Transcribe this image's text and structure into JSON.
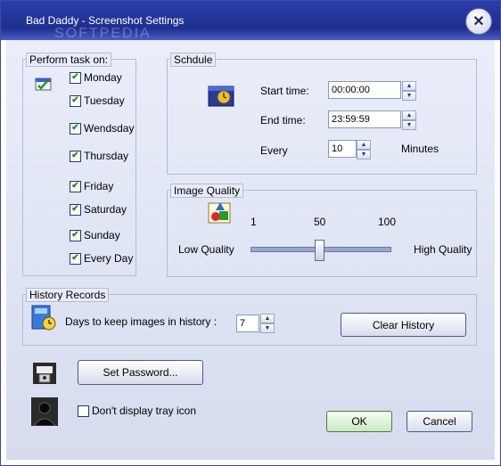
{
  "window": {
    "title": "Bad Daddy - Screenshot Settings",
    "watermark": "SOFTPEDIA",
    "close_symbol": "✕"
  },
  "perform_task": {
    "legend": "Perform task on:",
    "days": [
      {
        "label": "Monday",
        "checked": true
      },
      {
        "label": "Tuesday",
        "checked": true
      },
      {
        "label": "Wendsday",
        "checked": true
      },
      {
        "label": "Thursday",
        "checked": true
      },
      {
        "label": "Friday",
        "checked": true
      },
      {
        "label": "Saturday",
        "checked": true
      },
      {
        "label": "Sunday",
        "checked": true
      },
      {
        "label": "Every Day",
        "checked": true
      }
    ]
  },
  "schedule": {
    "legend": "Schdule",
    "start_label": "Start time:",
    "start_value": "00:00:00",
    "end_label": "End time:",
    "end_value": "23:59:59",
    "every_label": "Every",
    "every_value": "10",
    "minutes_label": "Minutes"
  },
  "image_quality": {
    "legend": "Image Quality",
    "tick_min": "1",
    "tick_mid": "50",
    "tick_max": "100",
    "low_label": "Low Quality",
    "high_label": "High Quality",
    "value": 50,
    "min": 1,
    "max": 100
  },
  "history": {
    "legend": "History Records",
    "days_label": "Days to keep images in history :",
    "days_value": "7",
    "clear_button": "Clear History"
  },
  "buttons": {
    "set_password": "Set Password...",
    "ok": "OK",
    "cancel": "Cancel"
  },
  "tray": {
    "label": "Don't display tray icon",
    "checked": false
  },
  "colors": {
    "title_bar": "#1f2f8f",
    "client_bg": "#e4e8f6",
    "ok_border": "#3e7e3e"
  },
  "icons": [
    "close-icon",
    "calendar-icon",
    "clock-icon",
    "quality-icon",
    "history-icon",
    "password-icon",
    "user-silhouette-icon",
    "check-mark-icon"
  ]
}
